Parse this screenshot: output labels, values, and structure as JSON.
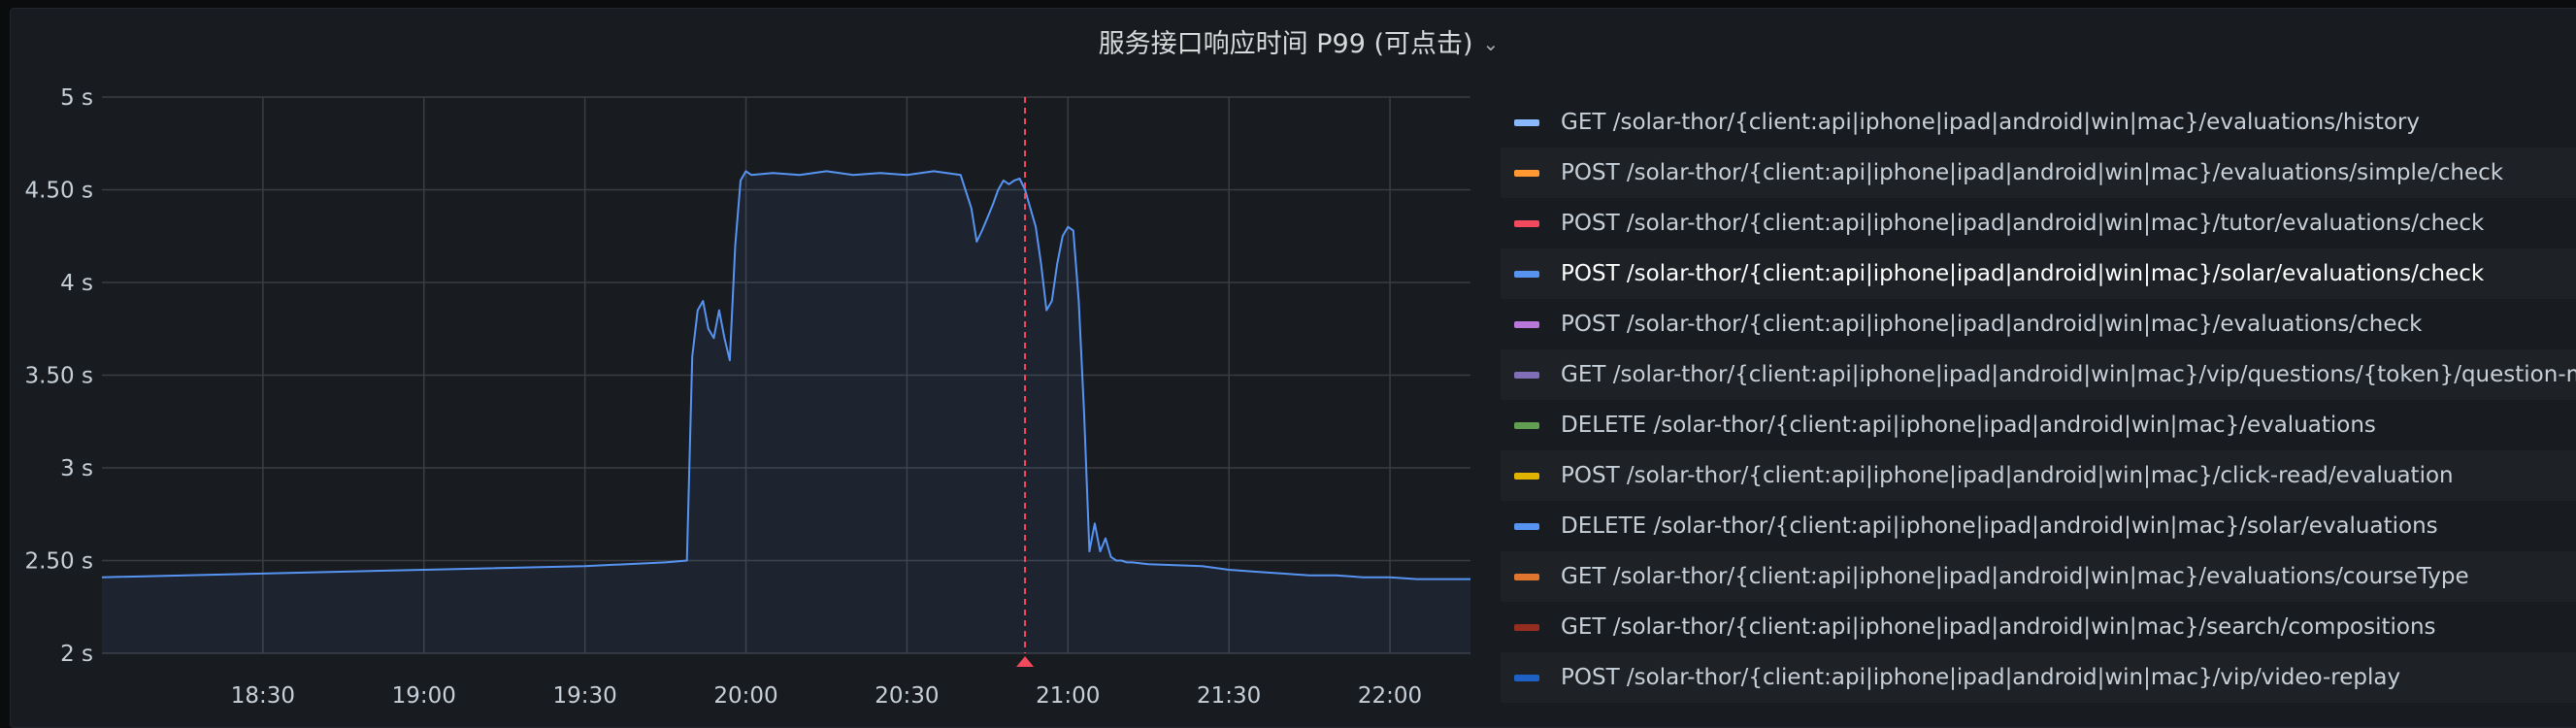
{
  "panel": {
    "title": "服务接口响应时间 P99 (可点击)"
  },
  "chart_data": {
    "type": "line",
    "ylim": [
      2,
      5
    ],
    "y_ticks": [
      "5 s",
      "4.50 s",
      "4 s",
      "3.50 s",
      "3 s",
      "2.50 s",
      "2 s"
    ],
    "x_ticks": [
      "18:30",
      "19:00",
      "19:30",
      "20:00",
      "20:30",
      "21:00",
      "21:30",
      "22:00"
    ],
    "x_range": [
      "18:00",
      "22:15"
    ],
    "grid": true,
    "legend_position": "right",
    "annotation_time": "20:52",
    "series": [
      {
        "name": "POST /solar-thor/{client:api|iphone|ipad|android|win|mac}/solar/evaluations/check",
        "color": "#5794f2",
        "x": [
          "18:00",
          "18:30",
          "19:00",
          "19:30",
          "19:45",
          "19:49",
          "19:50",
          "19:51",
          "19:52",
          "19:53",
          "19:54",
          "19:55",
          "19:56",
          "19:57",
          "19:58",
          "19:59",
          "20:00",
          "20:01",
          "20:05",
          "20:10",
          "20:15",
          "20:20",
          "20:25",
          "20:30",
          "20:35",
          "20:40",
          "20:42",
          "20:43",
          "20:44",
          "20:45",
          "20:46",
          "20:47",
          "20:48",
          "20:49",
          "20:50",
          "20:51",
          "20:52",
          "20:53",
          "20:54",
          "20:55",
          "20:56",
          "20:57",
          "20:58",
          "20:59",
          "21:00",
          "21:01",
          "21:02",
          "21:03",
          "21:04",
          "21:05",
          "21:06",
          "21:07",
          "21:08",
          "21:09",
          "21:10",
          "21:11",
          "21:12",
          "21:15",
          "21:25",
          "21:30",
          "21:35",
          "21:40",
          "21:45",
          "21:50",
          "21:55",
          "22:00",
          "22:05",
          "22:10",
          "22:15"
        ],
        "y": [
          2.41,
          2.43,
          2.45,
          2.47,
          2.49,
          2.5,
          3.6,
          3.85,
          3.9,
          3.75,
          3.7,
          3.85,
          3.7,
          3.58,
          4.2,
          4.55,
          4.6,
          4.58,
          4.59,
          4.58,
          4.6,
          4.58,
          4.59,
          4.58,
          4.6,
          4.58,
          4.4,
          4.22,
          4.28,
          4.35,
          4.42,
          4.5,
          4.55,
          4.53,
          4.55,
          4.56,
          4.5,
          4.4,
          4.3,
          4.1,
          3.85,
          3.9,
          4.1,
          4.25,
          4.3,
          4.28,
          3.9,
          3.3,
          2.55,
          2.7,
          2.55,
          2.62,
          2.52,
          2.5,
          2.5,
          2.49,
          2.49,
          2.48,
          2.47,
          2.45,
          2.44,
          2.43,
          2.42,
          2.42,
          2.41,
          2.41,
          2.4,
          2.4,
          2.4
        ]
      }
    ],
    "legend": [
      {
        "label": "GET /solar-thor/{client:api|iphone|ipad|android|win|mac}/evaluations/history",
        "color": "#8ab8ff"
      },
      {
        "label": "POST /solar-thor/{client:api|iphone|ipad|android|win|mac}/evaluations/simple/check",
        "color": "#ff9830"
      },
      {
        "label": "POST /solar-thor/{client:api|iphone|ipad|android|win|mac}/tutor/evaluations/check",
        "color": "#f2495c"
      },
      {
        "label": "POST /solar-thor/{client:api|iphone|ipad|android|win|mac}/solar/evaluations/check",
        "color": "#5794f2",
        "highlight": true
      },
      {
        "label": "POST /solar-thor/{client:api|iphone|ipad|android|win|mac}/evaluations/check",
        "color": "#b877d9"
      },
      {
        "label": "GET /solar-thor/{client:api|iphone|ipad|android|win|mac}/vip/questions/{token}/question-multi-video",
        "color": "#806eb7"
      },
      {
        "label": "DELETE /solar-thor/{client:api|iphone|ipad|android|win|mac}/evaluations",
        "color": "#629e51"
      },
      {
        "label": "POST /solar-thor/{client:api|iphone|ipad|android|win|mac}/click-read/evaluation",
        "color": "#e0b400"
      },
      {
        "label": "DELETE /solar-thor/{client:api|iphone|ipad|android|win|mac}/solar/evaluations",
        "color": "#5794f2"
      },
      {
        "label": "GET /solar-thor/{client:api|iphone|ipad|android|win|mac}/evaluations/courseType",
        "color": "#e0752d"
      },
      {
        "label": "GET /solar-thor/{client:api|iphone|ipad|android|win|mac}/search/compositions",
        "color": "#962d21"
      },
      {
        "label": "POST /solar-thor/{client:api|iphone|ipad|android|win|mac}/vip/video-replay",
        "color": "#1f60c4"
      }
    ]
  }
}
